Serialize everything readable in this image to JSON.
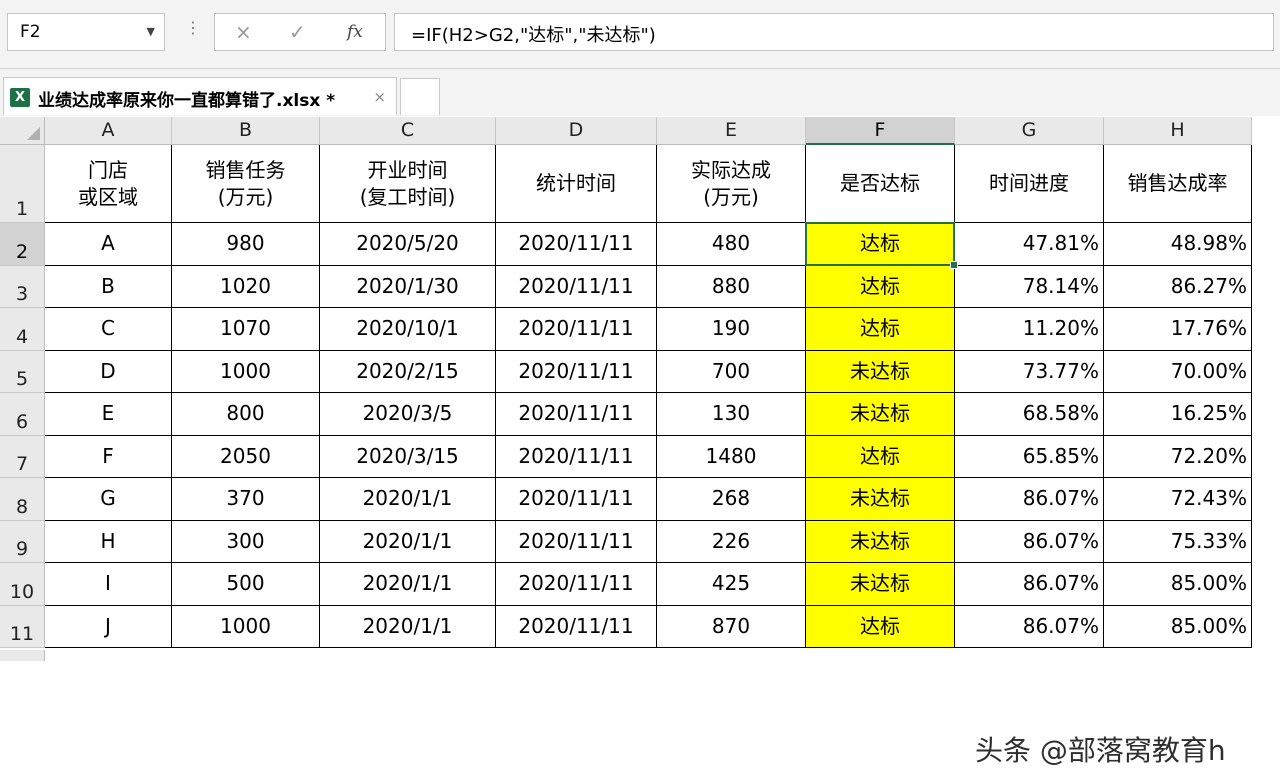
{
  "formula_bar": {
    "name_box": "F2",
    "cancel_icon": "×",
    "enter_icon": "✓",
    "fx_label": "fx",
    "formula": "=IF(H2>G2,\"达标\",\"未达标\")"
  },
  "workbook_tab": {
    "icon_text": "X",
    "filename": "业绩达成率原来你一直都算错了.xlsx *",
    "close_icon": "×"
  },
  "sheet": {
    "columns": [
      "A",
      "B",
      "C",
      "D",
      "E",
      "F",
      "G",
      "H"
    ],
    "rows": [
      "1",
      "2",
      "3",
      "4",
      "5",
      "6",
      "7",
      "8",
      "9",
      "10",
      "11"
    ],
    "headers": [
      "门店\n或区域",
      "销售任务\n(万元)",
      "开业时间\n(复工时间)",
      "统计时间",
      "实际达成\n(万元)",
      "是否达标",
      "时间进度",
      "销售达成率"
    ],
    "data": [
      [
        "A",
        "980",
        "2020/5/20",
        "2020/11/11",
        "480",
        "达标",
        "47.81%",
        "48.98%"
      ],
      [
        "B",
        "1020",
        "2020/1/30",
        "2020/11/11",
        "880",
        "达标",
        "78.14%",
        "86.27%"
      ],
      [
        "C",
        "1070",
        "2020/10/1",
        "2020/11/11",
        "190",
        "达标",
        "11.20%",
        "17.76%"
      ],
      [
        "D",
        "1000",
        "2020/2/15",
        "2020/11/11",
        "700",
        "未达标",
        "73.77%",
        "70.00%"
      ],
      [
        "E",
        "800",
        "2020/3/5",
        "2020/11/11",
        "130",
        "未达标",
        "68.58%",
        "16.25%"
      ],
      [
        "F",
        "2050",
        "2020/3/15",
        "2020/11/11",
        "1480",
        "达标",
        "65.85%",
        "72.20%"
      ],
      [
        "G",
        "370",
        "2020/1/1",
        "2020/11/11",
        "268",
        "未达标",
        "86.07%",
        "72.43%"
      ],
      [
        "H",
        "300",
        "2020/1/1",
        "2020/11/11",
        "226",
        "未达标",
        "86.07%",
        "75.33%"
      ],
      [
        "I",
        "500",
        "2020/1/1",
        "2020/11/11",
        "425",
        "未达标",
        "86.07%",
        "85.00%"
      ],
      [
        "J",
        "1000",
        "2020/1/1",
        "2020/11/11",
        "870",
        "达标",
        "86.07%",
        "85.00%"
      ]
    ],
    "selected_cell": "F2",
    "highlight_color": "#ffff00",
    "selection_color": "#217346"
  },
  "watermark": "头条 @部落窝教育h"
}
